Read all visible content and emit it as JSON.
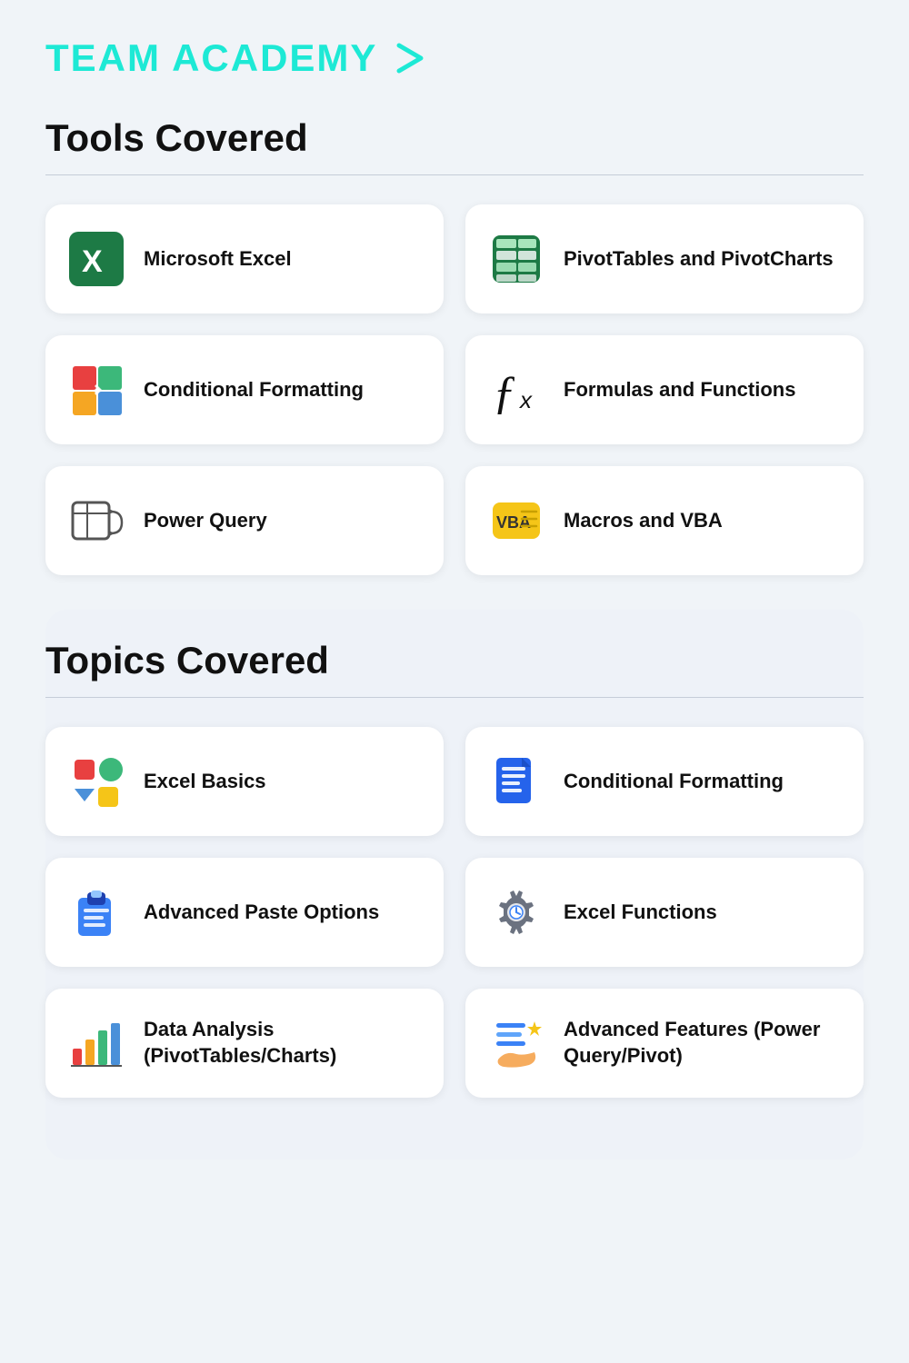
{
  "brand": {
    "name": "TEAM ACADEMY",
    "arrow": "›"
  },
  "tools_section": {
    "title": "Tools Covered",
    "cards": [
      {
        "id": "microsoft-excel",
        "label": "Microsoft Excel",
        "icon_type": "excel"
      },
      {
        "id": "pivottables",
        "label": "PivotTables and PivotCharts",
        "icon_type": "pivot"
      },
      {
        "id": "conditional-formatting",
        "label": "Conditional Formatting",
        "icon_type": "cond_fmt"
      },
      {
        "id": "formulas-functions",
        "label": "Formulas and Functions",
        "icon_type": "formula"
      },
      {
        "id": "power-query",
        "label": "Power Query",
        "icon_type": "power_query"
      },
      {
        "id": "macros-vba",
        "label": "Macros and VBA",
        "icon_type": "vba"
      }
    ]
  },
  "topics_section": {
    "title": "Topics Covered",
    "cards": [
      {
        "id": "excel-basics",
        "label": "Excel Basics",
        "icon_type": "basics"
      },
      {
        "id": "conditional-fmt-topic",
        "label": "Conditional Formatting",
        "icon_type": "cond_fmt_topic"
      },
      {
        "id": "advanced-paste",
        "label": "Advanced Paste Options",
        "icon_type": "paste"
      },
      {
        "id": "excel-functions",
        "label": "Excel Functions",
        "icon_type": "functions"
      },
      {
        "id": "data-analysis",
        "label": "Data Analysis (PivotTables/Charts)",
        "icon_type": "analysis"
      },
      {
        "id": "advanced-features",
        "label": "Advanced Features (Power Query/Pivot)",
        "icon_type": "advanced"
      }
    ]
  }
}
